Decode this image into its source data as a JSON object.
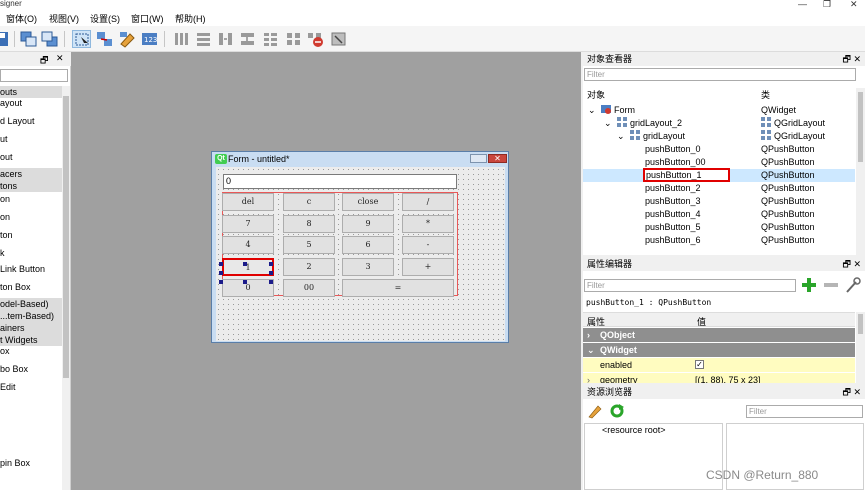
{
  "window": {
    "title_fragment": "signer"
  },
  "menubar": [
    "窗体(O)",
    "视图(V)",
    "设置(S)",
    "窗口(W)",
    "帮助(H)"
  ],
  "left_panel": {
    "items": [
      {
        "text": "outs",
        "cat": true
      },
      {
        "text": "ayout",
        "cat": false
      },
      {
        "text": "d Layout",
        "cat": false
      },
      {
        "text": "ut",
        "cat": false
      },
      {
        "text": "out",
        "cat": false
      },
      {
        "text": "acers",
        "cat": true
      },
      {
        "text": "tons",
        "cat": true
      },
      {
        "text": "on",
        "cat": false
      },
      {
        "text": "on",
        "cat": false
      },
      {
        "text": "ton",
        "cat": false
      },
      {
        "text": "k",
        "cat": false
      },
      {
        "text": "Link Button",
        "cat": false
      },
      {
        "text": "ton Box",
        "cat": false
      },
      {
        "text": "odel-Based)",
        "cat": true
      },
      {
        "text": "...tem-Based)",
        "cat": true
      },
      {
        "text": "ainers",
        "cat": true
      },
      {
        "text": "t Widgets",
        "cat": true
      },
      {
        "text": "ox",
        "cat": false
      },
      {
        "text": "bo Box",
        "cat": false
      },
      {
        "text": "Edit",
        "cat": false
      },
      {
        "text": "pin Box",
        "cat": false
      }
    ]
  },
  "form": {
    "title": "Form - untitled*",
    "qt_badge": "Qt",
    "close_glyph": "✕",
    "display_value": "0",
    "buttons": [
      "del",
      "c",
      "close",
      "/",
      "7",
      "8",
      "9",
      "*",
      "4",
      "5",
      "6",
      "-",
      "1",
      "2",
      "3",
      "+",
      "0",
      "00",
      "="
    ]
  },
  "object_inspector": {
    "title": "对象查看器",
    "filter_placeholder": "Filter",
    "col_object": "对象",
    "col_class": "类",
    "rows": [
      {
        "name": "Form",
        "cls": "QWidget"
      },
      {
        "name": "gridLayout_2",
        "cls": "QGridLayout"
      },
      {
        "name": "gridLayout",
        "cls": "QGridLayout"
      },
      {
        "name": "pushButton_0",
        "cls": "QPushButton"
      },
      {
        "name": "pushButton_00",
        "cls": "QPushButton"
      },
      {
        "name": "pushButton_1",
        "cls": "QPushButton"
      },
      {
        "name": "pushButton_2",
        "cls": "QPushButton"
      },
      {
        "name": "pushButton_3",
        "cls": "QPushButton"
      },
      {
        "name": "pushButton_4",
        "cls": "QPushButton"
      },
      {
        "name": "pushButton_5",
        "cls": "QPushButton"
      },
      {
        "name": "pushButton_6",
        "cls": "QPushButton"
      }
    ]
  },
  "property_editor": {
    "title": "属性编辑器",
    "filter_placeholder": "Filter",
    "object_label": "pushButton_1 : QPushButton",
    "col_property": "属性",
    "col_value": "值",
    "groups": [
      "QObject",
      "QWidget"
    ],
    "enabled_label": "enabled",
    "enabled_value": "✓",
    "geometry_label": "geometry",
    "geometry_value": "[(1, 88), 75 x 23]"
  },
  "resource_browser": {
    "title": "资源浏览器",
    "filter_placeholder": "Filter",
    "root": "<resource root>"
  },
  "panel_controls": "🗗 ✕",
  "watermark": "CSDN @Return_880",
  "colors": {
    "selection": "#cde8ff",
    "highlight_red": "#e00000",
    "property_group": "#8f8f8f",
    "enabled_row": "#fffcc0"
  }
}
